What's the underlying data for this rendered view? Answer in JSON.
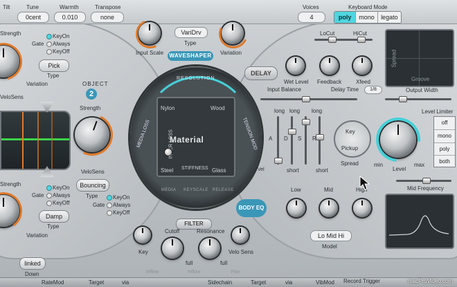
{
  "top_bar": {
    "tilt_label": "Tilt",
    "tune_label": "Tune",
    "tune_value": "0cent",
    "warmth_label": "Warmth",
    "warmth_value": "0.010",
    "transpose_label": "Transpose",
    "transpose_value": "none",
    "voices_label": "Voices",
    "voices_value": "4",
    "keyboard_mode_label": "Keyboard Mode",
    "keyboard_modes": [
      "poly",
      "mono",
      "legato"
    ],
    "keyboard_mode_selected": "poly"
  },
  "left_upper": {
    "strength_label": "Strength",
    "gate_label": "Gate",
    "gate_options": [
      "KeyOn",
      "Always",
      "KeyOff"
    ],
    "pick_label": "Pick",
    "type_label": "Type",
    "variation_label": "Variation",
    "velosens_label": "VeloSens"
  },
  "object2": {
    "object_label": "OBJECT",
    "object_number": "2",
    "strength_label": "Strength",
    "velosens_label": "VeloSens",
    "bouncing_label": "Bouncing",
    "type_label": "Type",
    "gate_label": "Gate",
    "gate_options": [
      "KeyOn",
      "Always",
      "KeyOff"
    ]
  },
  "left_lower": {
    "strength_label": "Strength",
    "gate_label": "Gate",
    "gate_options": [
      "KeyOn",
      "Always",
      "KeyOff"
    ],
    "damp_label": "Damp",
    "type_label": "Type",
    "variation_label": "Variation",
    "linked_label": "linked",
    "down_label": "Down"
  },
  "waveshaper": {
    "input_scale_label": "Input Scale",
    "type_value": "VariDrv",
    "type_label": "Type",
    "variation_label": "Variation",
    "header": "WAVESHAPER"
  },
  "material": {
    "resolution_label": "RESOLUTION",
    "media_loss_label": "MEDIA LOSS",
    "tension_mod_label": "TENSION MOD",
    "nylon": "Nylon",
    "wood": "Wood",
    "steel": "Steel",
    "glass": "Glass",
    "title": "Material",
    "stiffness": "STIFFNESS",
    "inner_loss": "INNER LOSS",
    "bottom_tabs": [
      "MEDIA",
      "KEYSCALE",
      "RELEASE"
    ]
  },
  "delay": {
    "title": "DELAY",
    "wet_level_label": "Wet Level",
    "feedback_label": "Feedback",
    "lowcut_label": "LoCut",
    "hicut_label": "HiCut",
    "xfeed_label": "Xfeed",
    "input_balance_label": "Input Balance",
    "delay_time_label": "Delay Time",
    "delay_time_value": "1/8",
    "spread_label": "Spread",
    "groove_label": "Groove",
    "output_width_label": "Output Width"
  },
  "envelope": {
    "letters": [
      "A",
      "D",
      "S",
      "R"
    ],
    "long_label": "long",
    "short_label": "short",
    "vel_label": "Vel"
  },
  "pickup": {
    "key_label": "Key",
    "pickup_label": "Pickup",
    "spread_label": "Spread",
    "level_label": "Level",
    "min_label": "min",
    "max_label": "max",
    "level_limiter_label": "Level Limiter",
    "limiter_options": [
      "off",
      "mono",
      "poly",
      "both"
    ]
  },
  "body_eq": {
    "title": "BODY EQ",
    "low_label": "Low",
    "mid_label": "Mid",
    "high_label": "High",
    "mid_frequency_label": "Mid Frequency",
    "model_value": "Lo Mid Hi",
    "model_label": "Model"
  },
  "filter": {
    "title": "FILTER",
    "cutoff_label": "Cutoff",
    "resonance_label": "Resonance",
    "key_label": "Key",
    "velo_sens_label": "Velo Sens",
    "full_label": "full",
    "bottom_tabs": [
      "Inflow",
      "Inflow",
      "Pan"
    ]
  },
  "bottom_bar": {
    "ratemod_label": "RateMod",
    "target_label": "Target",
    "via_label": "via",
    "sidechain_label": "Sidechain",
    "record_trigger_label": "Record Trigger",
    "vibmod_label": "VibMod"
  },
  "watermark": "macProVideo.com",
  "colors": {
    "accent_orange": "#e07a2a",
    "accent_cyan": "#45d0d8",
    "badge_blue": "#3a97b8",
    "panel_silver": "#c4c8cb"
  }
}
